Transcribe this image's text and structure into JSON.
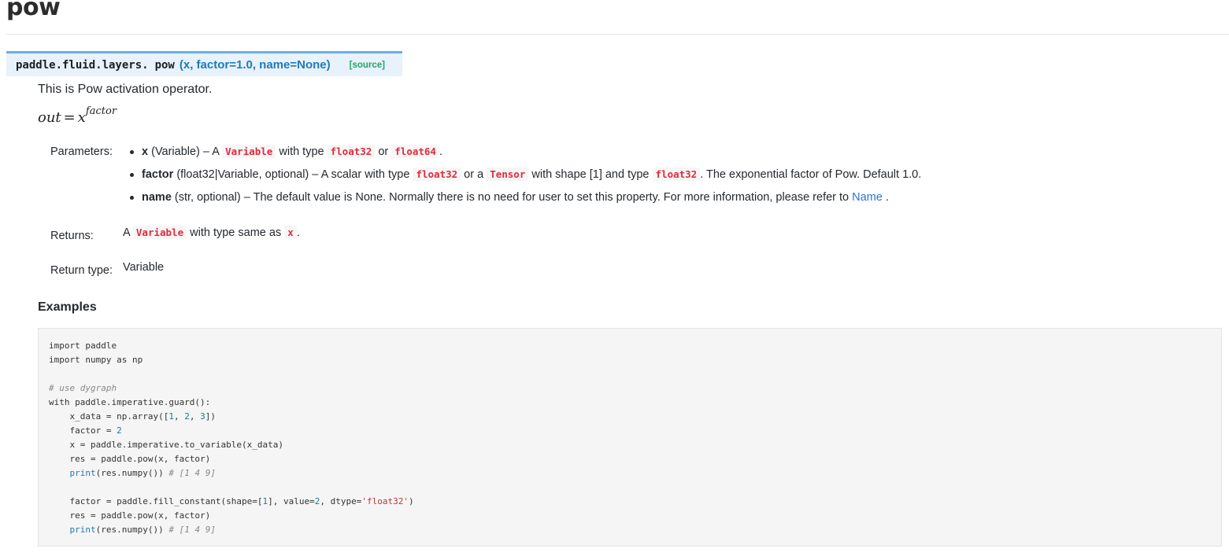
{
  "page": {
    "title": "pow"
  },
  "signature": {
    "prefix": "paddle.fluid.layers.",
    "name": "pow",
    "params": "(x, factor=1.0, name=None)",
    "source_label": "[source]"
  },
  "description": "This is Pow activation operator.",
  "formula": {
    "lhs": "out",
    "eq": "=",
    "base": "x",
    "exponent": "factor"
  },
  "parameters": {
    "label": "Parameters:",
    "items": [
      {
        "name": "x",
        "type": "(Variable)",
        "dash": " – A ",
        "code1": "Variable",
        "mid1": " with type ",
        "code2": "float32",
        "mid2": " or ",
        "code3": "float64",
        "end": "."
      },
      {
        "name": "factor",
        "type": "(float32|Variable, optional)",
        "dash": " – A scalar with type ",
        "code1": "float32",
        "mid1": " or a ",
        "code2": "Tensor",
        "mid2": " with shape [1] and type ",
        "code3": "float32",
        "end": ". The exponential factor of Pow. Default 1.0."
      },
      {
        "name": "name",
        "type": "(str, optional)",
        "text": " – The default value is None. Normally there is no need for user to set this property. For more information, please refer to ",
        "link": "Name",
        "end": "."
      }
    ]
  },
  "returns": {
    "label": "Returns:",
    "pre": "A ",
    "code1": "Variable",
    "mid": " with type same as ",
    "code2": "x",
    "end": "."
  },
  "return_type": {
    "label": "Return type:",
    "value": "Variable"
  },
  "examples": {
    "heading": "Examples",
    "code_lines": [
      [
        {
          "t": "import paddle"
        }
      ],
      [
        {
          "t": "import numpy as np"
        }
      ],
      [],
      [
        {
          "t": "# use dygraph",
          "k": "c"
        }
      ],
      [
        {
          "t": "with paddle.imperative.guard():"
        }
      ],
      [
        {
          "t": "    x_data = np.array(["
        },
        {
          "t": "1",
          "k": "n"
        },
        {
          "t": ", "
        },
        {
          "t": "2",
          "k": "n"
        },
        {
          "t": ", "
        },
        {
          "t": "3",
          "k": "n"
        },
        {
          "t": "])"
        }
      ],
      [
        {
          "t": "    factor = "
        },
        {
          "t": "2",
          "k": "n"
        }
      ],
      [
        {
          "t": "    x = paddle.imperative.to_variable(x_data)"
        }
      ],
      [
        {
          "t": "    res = paddle.pow(x, factor)"
        }
      ],
      [
        {
          "t": "    "
        },
        {
          "t": "print",
          "k": "b"
        },
        {
          "t": "(res.numpy()) "
        },
        {
          "t": "# [1 4 9]",
          "k": "c"
        }
      ],
      [],
      [
        {
          "t": "    factor = paddle.fill_constant(shape=["
        },
        {
          "t": "1",
          "k": "n"
        },
        {
          "t": "], value="
        },
        {
          "t": "2",
          "k": "n"
        },
        {
          "t": ", dtype="
        },
        {
          "t": "'float32'",
          "k": "s"
        },
        {
          "t": ")"
        }
      ],
      [
        {
          "t": "    res = paddle.pow(x, factor)"
        }
      ],
      [
        {
          "t": "    "
        },
        {
          "t": "print",
          "k": "b"
        },
        {
          "t": "(res.numpy()) "
        },
        {
          "t": "# [1 4 9]",
          "k": "c"
        }
      ]
    ]
  }
}
